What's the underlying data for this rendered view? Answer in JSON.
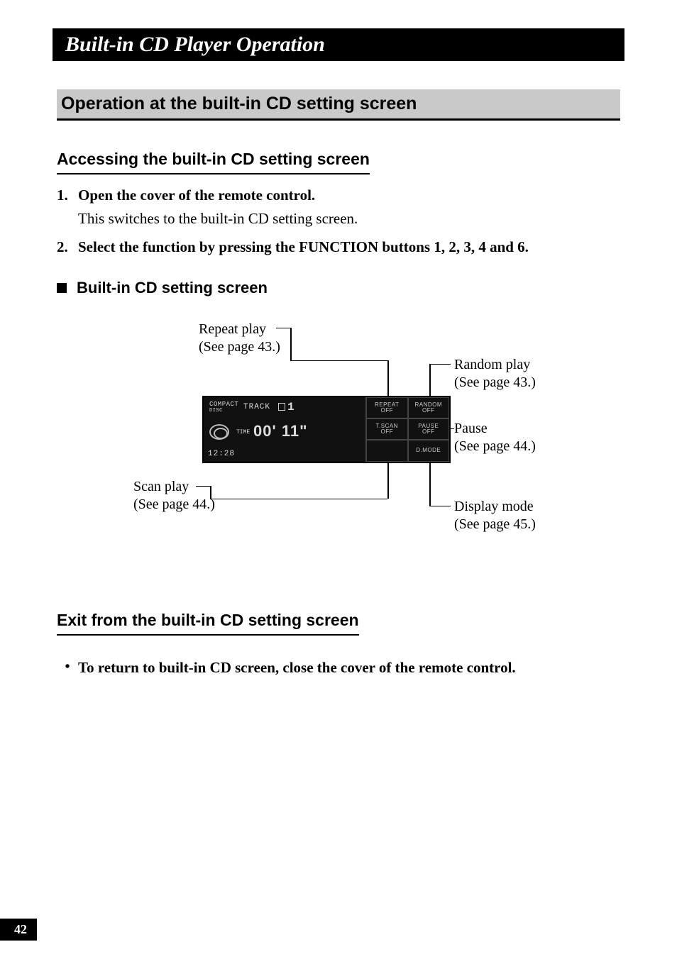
{
  "title_bar": "Built-in CD Player Operation",
  "section_header": "Operation at the built-in CD setting screen",
  "subsection1": "Accessing the built-in CD setting screen",
  "steps": [
    {
      "num": "1.",
      "title": "Open the cover of the remote control.",
      "desc": "This switches to the built-in CD setting screen."
    },
    {
      "num": "2.",
      "title": "Select the function by pressing the FUNCTION buttons 1, 2, 3, 4 and 6.",
      "desc": ""
    }
  ],
  "diagram_heading": "Built-in CD setting screen",
  "callouts": {
    "repeat": {
      "line1": "Repeat play",
      "line2": "(See page 43.)"
    },
    "random": {
      "line1": "Random play",
      "line2": "(See page 43.)"
    },
    "pause": {
      "line1": "Pause",
      "line2": "(See page 44.)"
    },
    "scan": {
      "line1": "Scan play",
      "line2": "(See page 44.)"
    },
    "dmode": {
      "line1": "Display mode",
      "line2": "(See page 45.)"
    }
  },
  "device": {
    "compact_top": "COMPACT",
    "compact_bot": "DISC",
    "track_label": "TRACK",
    "track_number": "1",
    "time_label": "TIME",
    "time_value": "00' 11\"",
    "clock": "12:28",
    "btn_repeat_top": "REPEAT",
    "btn_repeat_bot": "OFF",
    "btn_random_top": "RANDOM",
    "btn_random_bot": "OFF",
    "btn_tscan_top": "T.SCAN",
    "btn_tscan_bot": "OFF",
    "btn_pause_top": "PAUSE",
    "btn_pause_bot": "OFF",
    "btn_dmode": "D.MODE"
  },
  "subsection2": "Exit from the built-in CD setting screen",
  "exit_text": "To return to built-in CD screen, close the cover of the remote control.",
  "page_number": "42"
}
